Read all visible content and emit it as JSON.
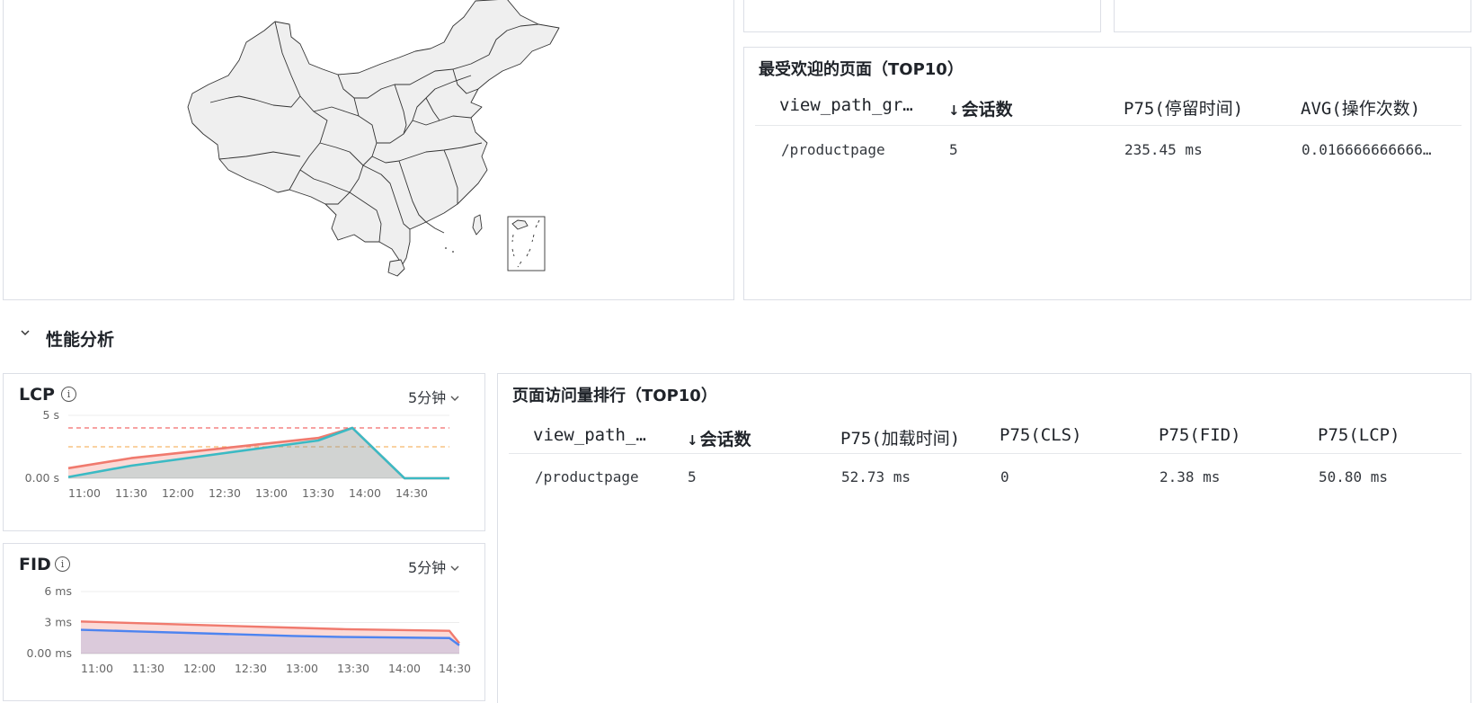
{
  "map_panel": {
    "region": "China provinces map"
  },
  "top_pages": {
    "title": "最受欢迎的页面（TOP10）",
    "columns": [
      "view_path_gr…",
      "会话数",
      "P75(停留时间)",
      "AVG(操作次数)"
    ],
    "sort_column": "会话数",
    "rows": [
      {
        "path": "/productpage",
        "sessions": "5",
        "p75_stay": "235.45 ms",
        "avg_ops": "0.016666666666…"
      }
    ]
  },
  "performance_section": {
    "title": "性能分析",
    "toggle_icon": "chevron-down-icon"
  },
  "lcp_chart": {
    "title": "LCP",
    "interval": "5分钟",
    "chart_data": {
      "type": "area",
      "title": "LCP",
      "x": [
        "11:00",
        "11:30",
        "12:00",
        "12:30",
        "13:00",
        "13:30",
        "14:00",
        "14:30"
      ],
      "yticks": [
        "5 s",
        "0.00 s"
      ],
      "thresholds_s": {
        "poor": 4.0,
        "needs_improvement": 2.5
      },
      "series": [
        {
          "color": "#f07a6e",
          "values_s": [
            0.8,
            1.6,
            2.4,
            3.2,
            4.0,
            0.0,
            0.0
          ]
        },
        {
          "color": "#3bbac4",
          "values_s": [
            0.1,
            1.0,
            2.0,
            3.0,
            4.0,
            0.0,
            0.0
          ]
        }
      ]
    }
  },
  "fid_chart": {
    "title": "FID",
    "interval": "5分钟",
    "chart_data": {
      "type": "area",
      "title": "FID",
      "x": [
        "11:00",
        "11:30",
        "12:00",
        "12:30",
        "13:00",
        "13:30",
        "14:00",
        "14:30"
      ],
      "yticks": [
        "6 ms",
        "3 ms",
        "0.00 ms"
      ],
      "series": [
        {
          "color": "#f07a6e",
          "values_ms": [
            3.1,
            2.95,
            2.8,
            2.65,
            2.5,
            2.35,
            2.2,
            1.0
          ]
        },
        {
          "color": "#4d84f0",
          "values_ms": [
            2.3,
            2.15,
            2.0,
            1.85,
            1.7,
            1.6,
            1.5,
            0.8
          ]
        }
      ]
    }
  },
  "page_visits": {
    "title": "页面访问量排行（TOP10）",
    "columns": [
      "view_path_…",
      "会话数",
      "P75(加载时间)",
      "P75(CLS)",
      "P75(FID)",
      "P75(LCP)"
    ],
    "sort_column": "会话数",
    "rows": [
      {
        "path": "/productpage",
        "sessions": "5",
        "p75_load": "52.73 ms",
        "p75_cls": "0",
        "p75_fid": "2.38 ms",
        "p75_lcp": "50.80 ms"
      }
    ]
  },
  "colors": {
    "border": "#dcdfe6",
    "map_fill": "#eeeeee",
    "lcp_red": "#f07a6e",
    "lcp_teal": "#3bbac4",
    "fid_blue": "#4d84f0",
    "threshold_red": "#f26b6b",
    "threshold_orange": "#f5b86b"
  }
}
